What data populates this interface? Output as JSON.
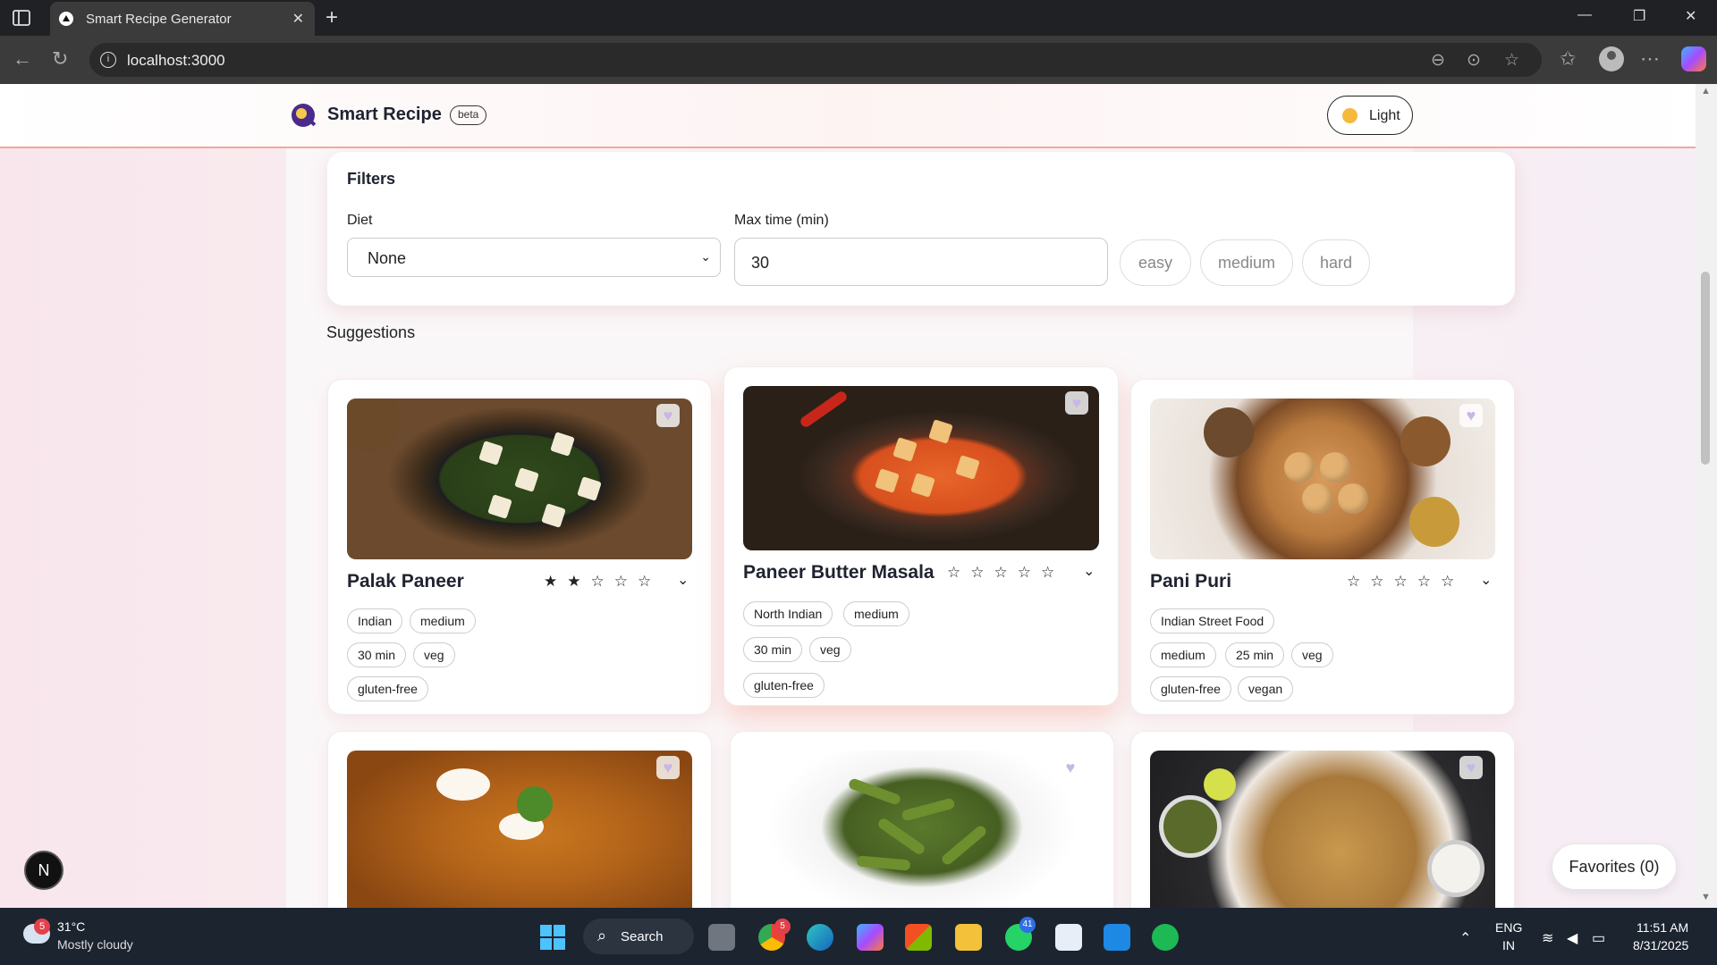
{
  "browser": {
    "tab_title": "Smart Recipe Generator",
    "url": "localhost:3000",
    "new_tab": "+",
    "tab_close": "✕",
    "minimize": "—",
    "maximize": "❐",
    "close": "✕"
  },
  "header": {
    "brand": "Smart Recipe",
    "badge": "beta",
    "theme_label": "Light"
  },
  "filters": {
    "title": "Filters",
    "diet_label": "Diet",
    "diet_value": "None",
    "max_time_label": "Max time (min)",
    "max_time_value": "30",
    "difficulty_chips": [
      "easy",
      "medium",
      "hard"
    ]
  },
  "suggestions_title": "Suggestions",
  "recipes": [
    {
      "title": "Palak Paneer",
      "rating": 2,
      "stars": "★★☆☆☆",
      "tags": [
        "Indian",
        "medium",
        "30 min",
        "veg",
        "gluten-free"
      ]
    },
    {
      "title": "Paneer Butter Masala",
      "rating": 0,
      "stars": "☆☆☆☆☆",
      "tags": [
        "North Indian",
        "medium",
        "30 min",
        "veg",
        "gluten-free"
      ]
    },
    {
      "title": "Pani Puri",
      "rating": 0,
      "stars": "☆☆☆☆☆",
      "tags": [
        "Indian Street Food",
        "medium",
        "25 min",
        "veg",
        "gluten-free",
        "vegan"
      ]
    }
  ],
  "favorites_button": "Favorites (0)",
  "next_badge": "N",
  "taskbar": {
    "weather_badge": "5",
    "temperature": "31°C",
    "weather": "Mostly cloudy",
    "search_label": "Search",
    "chrome_badge": "5",
    "whatsapp_badge": "41",
    "lang_1": "ENG",
    "lang_2": "IN",
    "time": "11:51 AM",
    "date": "8/31/2025"
  }
}
